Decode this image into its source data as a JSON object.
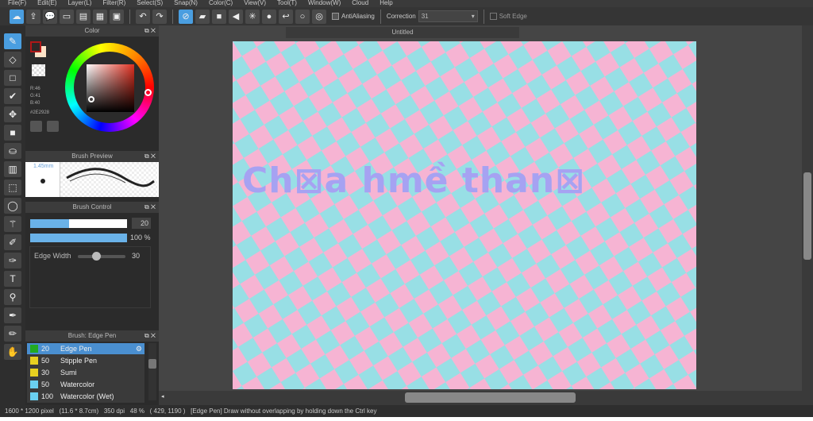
{
  "menu": [
    "File(F)",
    "Edit(E)",
    "Layer(L)",
    "Filter(R)",
    "Select(S)",
    "Snap(N)",
    "Color(C)",
    "View(V)",
    "Tool(T)",
    "Window(W)",
    "Cloud",
    "Help"
  ],
  "toolbar": {
    "antialiasing_label": "AntiAliasing",
    "correction_label": "Correction",
    "correction_value": "31",
    "soft_edge_label": "Soft Edge"
  },
  "color_panel": {
    "title": "Color",
    "r": "R:46",
    "g": "G:41",
    "b": "B:40",
    "hex": "#2E2928",
    "fg": "#2e2928",
    "bg": "#fde3c8"
  },
  "brush_preview": {
    "title": "Brush Preview",
    "size": "1.45mm"
  },
  "brush_control": {
    "title": "Brush Control",
    "size": "20",
    "size_fraction": 0.4,
    "opacity": "100 %",
    "opacity_fraction": 1.0,
    "edge_width_label": "Edge Width",
    "edge_width": "30"
  },
  "brush_list": {
    "title": "Brush: Edge Pen",
    "items": [
      {
        "size": "20",
        "name": "Edge Pen",
        "color": "#22aa22",
        "selected": true
      },
      {
        "size": "50",
        "name": "Stipple Pen",
        "color": "#e8d020"
      },
      {
        "size": "30",
        "name": "Sumi",
        "color": "#e8d020"
      },
      {
        "size": "50",
        "name": "Watercolor",
        "color": "#6ad0f0"
      },
      {
        "size": "100",
        "name": "Watercolor (Wet)",
        "color": "#6ad0f0"
      }
    ]
  },
  "document": {
    "tab": "Untitled",
    "art_text": "Ch⊠a hmề than⊠"
  },
  "status": {
    "dims": "1600 * 1200 pixel",
    "size": "(11.6 * 8.7cm)",
    "dpi": "350 dpi",
    "zoom": "48 %",
    "coords": "( 429, 1190 )",
    "hint": "[Edge Pen] Draw without overlapping by holding down the Ctrl key"
  }
}
